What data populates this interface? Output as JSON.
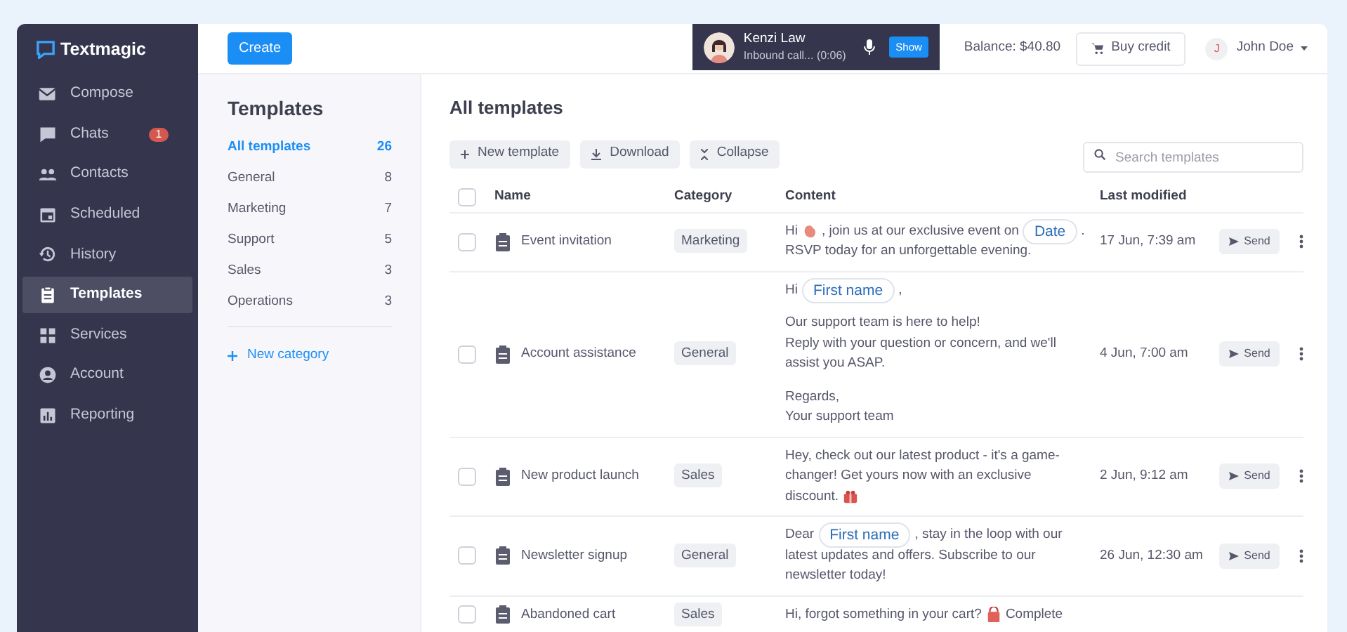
{
  "brand": "Textmagic",
  "sidebar": {
    "items": [
      {
        "label": "Compose",
        "selected": false
      },
      {
        "label": "Chats",
        "selected": false,
        "badge": "1"
      },
      {
        "label": "Contacts",
        "selected": false
      },
      {
        "label": "Scheduled",
        "selected": false
      },
      {
        "label": "History",
        "selected": false
      },
      {
        "label": "Templates",
        "selected": true
      },
      {
        "label": "Services",
        "selected": false
      },
      {
        "label": "Account",
        "selected": false
      },
      {
        "label": "Reporting",
        "selected": false
      }
    ]
  },
  "topbar": {
    "create": "Create",
    "call": {
      "name": "Kenzi Law",
      "status": "Inbound call... (0:06)",
      "show": "Show"
    },
    "balance": "Balance: $40.80",
    "buy_credit": "Buy credit",
    "user": {
      "initial": "J",
      "name": "John Doe"
    }
  },
  "categories": {
    "title": "Templates",
    "items": [
      {
        "label": "All templates",
        "count": "26",
        "selected": true
      },
      {
        "label": "General",
        "count": "8",
        "selected": false
      },
      {
        "label": "Marketing",
        "count": "7",
        "selected": false
      },
      {
        "label": "Support",
        "count": "5",
        "selected": false
      },
      {
        "label": "Sales",
        "count": "3",
        "selected": false
      },
      {
        "label": "Operations",
        "count": "3",
        "selected": false
      }
    ],
    "new_category": "New category"
  },
  "main": {
    "title": "All templates",
    "toolbar": [
      "New template",
      "Download",
      "Collapse"
    ],
    "search": {
      "placeholder": "Search templates"
    },
    "table": {
      "all_checked": false,
      "columns": [
        "Name",
        "Category",
        "Content",
        "Last modified"
      ],
      "rows": [
        {
          "name": "Event invitation",
          "category": "Marketing",
          "modified": "17 Jun, 7:39 am",
          "send": "Send",
          "checked": false,
          "content": [
            [
              {
                "kind": "text",
                "text": "Hi"
              },
              {
                "kind": "wave"
              },
              {
                "kind": "text",
                "text": ", join us at our exclusive event on"
              },
              {
                "kind": "chip",
                "text": "Date"
              },
              {
                "kind": "text",
                "text": "."
              }
            ],
            [
              {
                "kind": "text",
                "text": "RSVP today for an unforgettable evening."
              }
            ]
          ]
        },
        {
          "name": "Account assistance",
          "category": "General",
          "modified": "4 Jun, 7:00 am",
          "send": "Send",
          "checked": false,
          "content": [
            [
              {
                "kind": "text",
                "text": "Hi"
              },
              {
                "kind": "chip",
                "text": "First name"
              },
              {
                "kind": "text",
                "text": ","
              }
            ],
            {
              "kind": "break"
            },
            [
              {
                "kind": "text",
                "text": "Our support team is here to help!"
              }
            ],
            [
              {
                "kind": "text",
                "text": "Reply with your question or concern, and we'll"
              }
            ],
            [
              {
                "kind": "text",
                "text": "assist you ASAP."
              }
            ],
            {
              "kind": "break"
            },
            [
              {
                "kind": "text",
                "text": "Regards,"
              }
            ],
            [
              {
                "kind": "text",
                "text": "Your support team"
              }
            ]
          ]
        },
        {
          "name": "New product launch",
          "category": "Sales",
          "modified": "2 Jun, 9:12 am",
          "send": "Send",
          "checked": false,
          "content": [
            [
              {
                "kind": "text",
                "text": "Hey, check out our latest product - it's a game-"
              }
            ],
            [
              {
                "kind": "text",
                "text": "changer! Get yours now with an exclusive"
              }
            ],
            [
              {
                "kind": "text",
                "text": "discount."
              },
              {
                "kind": "gift"
              }
            ]
          ]
        },
        {
          "name": "Newsletter signup",
          "category": "General",
          "modified": "26 Jun, 12:30 am",
          "send": "Send",
          "checked": false,
          "content": [
            [
              {
                "kind": "text",
                "text": "Dear"
              },
              {
                "kind": "chip",
                "text": "First name"
              },
              {
                "kind": "text",
                "text": ", stay in the loop with our"
              }
            ],
            [
              {
                "kind": "text",
                "text": "latest updates and offers. Subscribe to our"
              }
            ],
            [
              {
                "kind": "text",
                "text": "newsletter today!"
              }
            ]
          ]
        },
        {
          "name": "Abandoned cart",
          "category": "Sales",
          "checked": false,
          "content": [
            [
              {
                "kind": "text",
                "text": "Hi, forgot something in your cart?"
              },
              {
                "kind": "bag"
              },
              {
                "kind": "text",
                "text": "Complete"
              }
            ]
          ]
        }
      ]
    }
  }
}
